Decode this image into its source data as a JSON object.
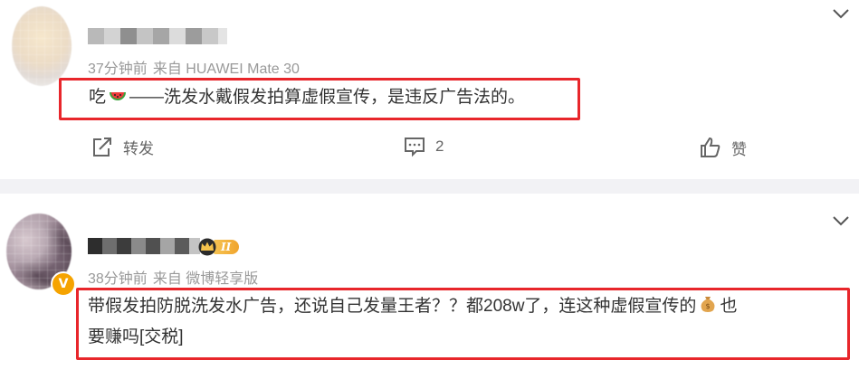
{
  "comments": [
    {
      "time": "37分钟前",
      "source": "来自 HUAWEI Mate 30",
      "text_parts": [
        "吃",
        "——洗发水戴假发拍算虚假宣传，是违反广告法的。"
      ],
      "emoji_1": "watermelon-emoji",
      "actions": {
        "repost_label": "转发",
        "comment_count": "2",
        "like_label": "赞"
      }
    },
    {
      "time": "38分钟前",
      "source": "来自 微博轻享版",
      "badge_level": "II",
      "verified_mark": "V",
      "text_line1_a": "带假发拍防脱洗发水广告，还说自己发量王者？？都208w了，连这种虚假宣传的",
      "text_line1_b": "也",
      "text_line2": "要赚吗[交税]",
      "emoji_1": "money-bag-emoji"
    }
  ],
  "colors": {
    "highlight": "#e8262b",
    "meta": "#999999",
    "separator": "#f2f2f5",
    "verified": "#f5a300"
  },
  "icons": [
    "chevron-down-icon",
    "repost-icon",
    "comment-icon",
    "like-icon",
    "crown-icon"
  ]
}
